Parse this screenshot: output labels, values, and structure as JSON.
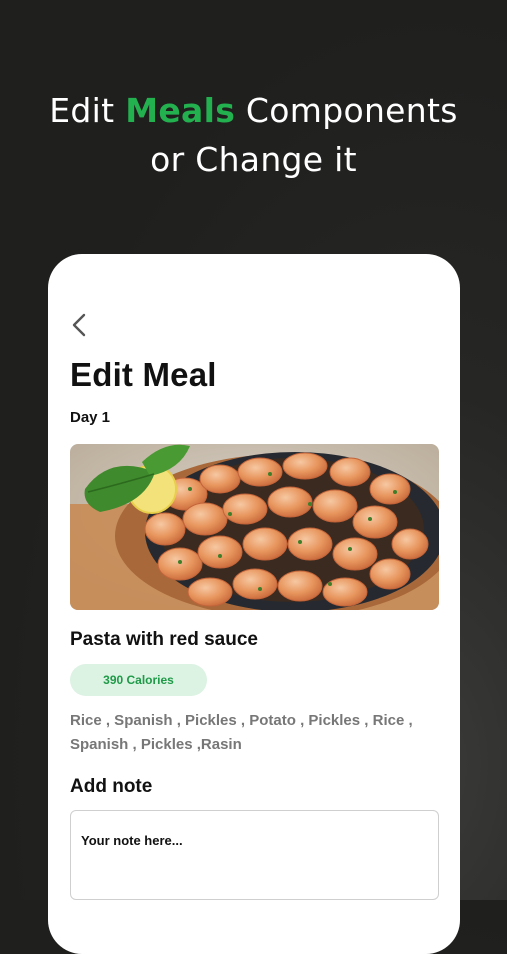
{
  "promo": {
    "line1_before": "Edit ",
    "line1_accent": "Meals",
    "line1_after": " Components",
    "line2": "or Change it",
    "accent_color": "#23b04f"
  },
  "screen": {
    "back_icon": "chevron-left-icon",
    "title": "Edit Meal",
    "day_label": "Day 1",
    "meal_image": "garlic-shrimp-skillet-photo",
    "meal_name": "Pasta with red sauce",
    "calories": "390 Calories",
    "ingredients": "Rice , Spanish , Pickles , Potato , Pickles , Rice , Spanish , Pickles ,Rasin",
    "note_label": "Add note",
    "note_placeholder": "Your note here...",
    "note_value": ""
  }
}
